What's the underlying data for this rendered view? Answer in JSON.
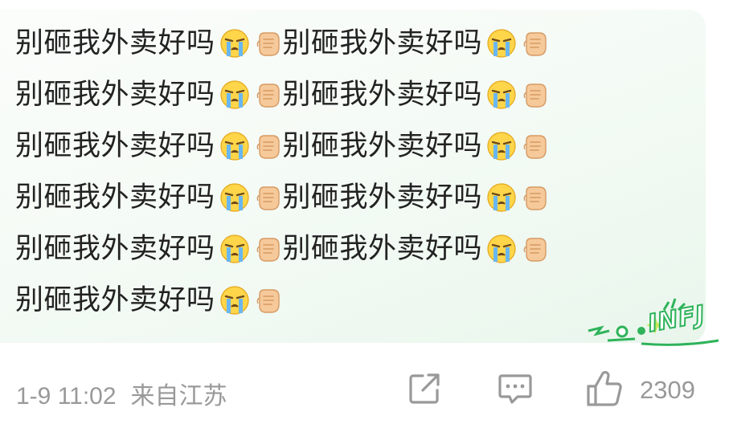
{
  "post": {
    "lines": [
      [
        "别砸我外卖好吗",
        "别砸我外卖好吗"
      ],
      [
        "别砸我外卖好吗",
        "别砸我外卖好吗"
      ],
      [
        "别砸我外卖好吗",
        "别砸我外卖好吗"
      ],
      [
        "别砸我外卖好吗",
        "别砸我外卖好吗"
      ],
      [
        "别砸我外卖好吗",
        "别砸我外卖好吗"
      ],
      [
        "别砸我外卖好吗"
      ]
    ],
    "emojis": [
      "crying-face-emoji",
      "raised-fist-emoji"
    ],
    "badge_label": "INFJ"
  },
  "footer": {
    "date": "1-9 11:02",
    "source": "来自江苏",
    "like_count": "2309"
  },
  "colors": {
    "text": "#222222",
    "meta": "#999999",
    "badge_green": "#2fb35a",
    "bubble_bg": "#f3faf4"
  }
}
